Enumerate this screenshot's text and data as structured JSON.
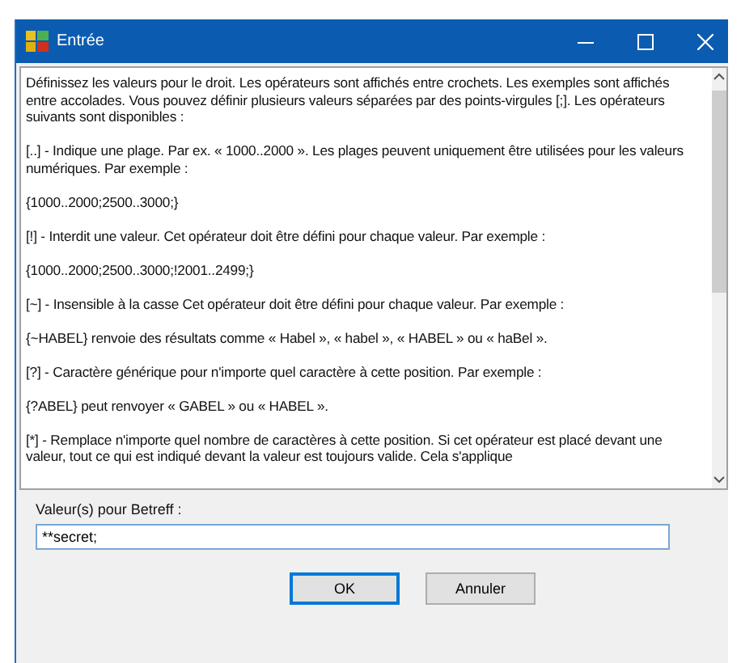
{
  "window": {
    "title": "Entrée"
  },
  "help_text": [
    "Définissez les valeurs pour le droit. Les opérateurs sont affichés entre crochets. Les exemples sont affichés entre accolades. Vous pouvez définir plusieurs valeurs séparées par des points-virgules [;]. Les opérateurs suivants sont disponibles :",
    "[..] - Indique une plage. Par ex. « 1000..2000 ». Les plages peuvent uniquement être utilisées pour les valeurs numériques. Par exemple :",
    "{1000..2000;2500..3000;}",
    "[!] - Interdit une valeur. Cet opérateur doit être défini pour chaque valeur. Par exemple :",
    "{1000..2000;2500..3000;!2001..2499;}",
    "[~] - Insensible à la casse Cet opérateur doit être défini pour chaque valeur. Par exemple :",
    "{~HABEL} renvoie des résultats comme « Habel », « habel », « HABEL » ou « haBel ».",
    "[?] - Caractère générique pour n'importe quel caractère à cette position. Par exemple :",
    "{?ABEL} peut renvoyer « GABEL » ou « HABEL ».",
    "[*] - Remplace n'importe quel nombre de caractères à cette position. Si cet opérateur est placé devant une valeur, tout ce qui est indiqué devant la valeur est toujours valide. Cela s'applique"
  ],
  "field": {
    "label": "Valeur(s) pour Betreff :",
    "value": "**secret;"
  },
  "buttons": [
    {
      "label": "OK",
      "default": true
    },
    {
      "label": "Annuler",
      "default": false
    }
  ]
}
